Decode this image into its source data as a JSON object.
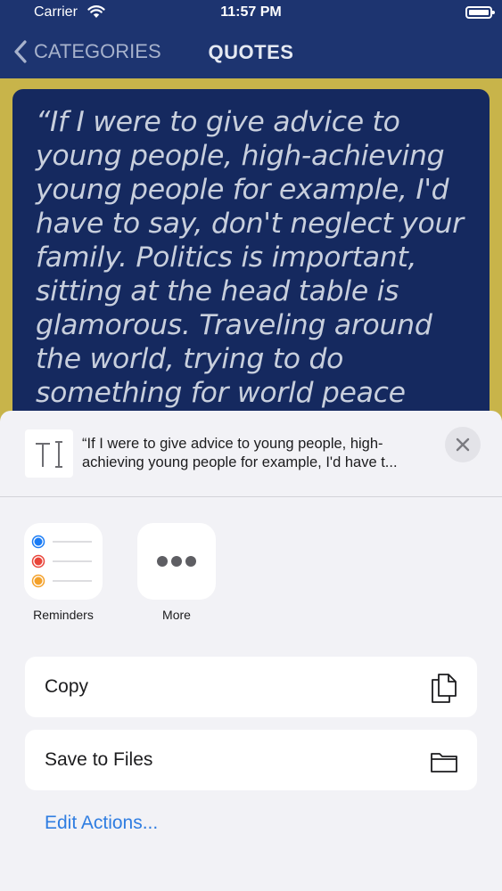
{
  "status_bar": {
    "carrier": "Carrier",
    "time": "11:57 PM"
  },
  "nav": {
    "back_label": "CATEGORIES",
    "title": "QUOTES"
  },
  "quote": {
    "text": "“If I were to give advice to young people, high-achieving young people for example, I'd have to say, don't neglect your family. Politics is important, sitting at the head table is glamorous. Traveling around the world, trying to do something for world peace"
  },
  "share_sheet": {
    "preview_text": "“If I were to give advice to young people, high-achieving young people for example, I'd have t...",
    "apps": [
      {
        "label": "Reminders",
        "icon": "reminders-icon"
      },
      {
        "label": "More",
        "icon": "more-icon"
      }
    ],
    "actions": [
      {
        "label": "Copy",
        "icon": "copy-icon"
      },
      {
        "label": "Save to Files",
        "icon": "folder-icon"
      }
    ],
    "edit_actions_label": "Edit Actions..."
  },
  "colors": {
    "nav_background": "#1d3470",
    "content_background": "#c8b44a",
    "quote_card": "#15295f",
    "sheet_background": "#f2f2f6",
    "link_blue": "#2f7de1",
    "reminder_blue": "#1a7cf5",
    "reminder_red": "#e9453a",
    "reminder_orange": "#f4a12a"
  }
}
